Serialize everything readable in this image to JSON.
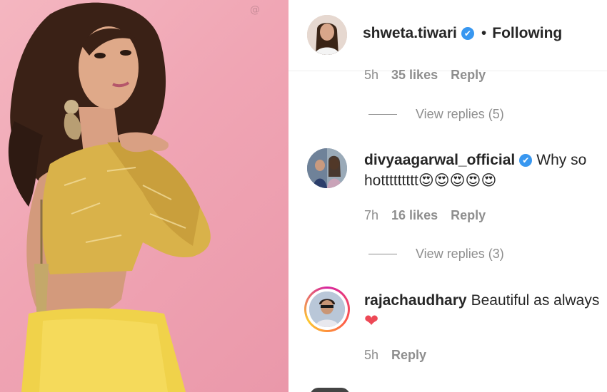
{
  "watermark": "@",
  "header": {
    "username": "shweta.tiwari",
    "separator": "•",
    "follow_status": "Following",
    "verified_glyph": "✔",
    "avatar_icon": "profile-photo-icon"
  },
  "comments": [
    {
      "time": "5h",
      "likes": "35 likes",
      "reply": "Reply",
      "view_replies": "View replies (5)"
    },
    {
      "username": "divyaagarwal_official",
      "verified_glyph": "✔",
      "text": "Why so hottttttttt",
      "emojis": "😍😍😍😍😍",
      "time": "7h",
      "likes": "16 likes",
      "reply": "Reply",
      "view_replies": "View replies (3)"
    },
    {
      "username": "rajachaudhary",
      "text": "Beautiful as always",
      "emojis": "❤",
      "time": "5h",
      "reply": "Reply"
    }
  ],
  "colors": {
    "photo_background": "#f0a5b4",
    "verified_blue": "#3897f0",
    "meta_gray": "#8e8e8e",
    "text_dark": "#262626",
    "heart_red": "#ed4956"
  }
}
